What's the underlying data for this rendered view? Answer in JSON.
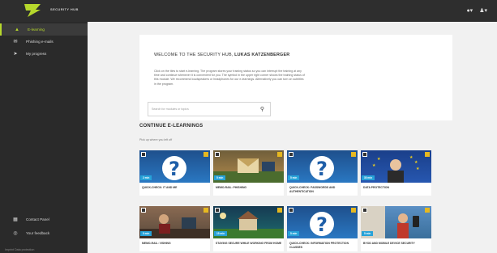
{
  "app": {
    "name": "SECURITY HUB",
    "brand_color": "#b6d82c"
  },
  "topbar": {
    "globe_icon": "globe-icon",
    "user_icon": "user-icon"
  },
  "sidebar": {
    "items": [
      {
        "label": "E-learning",
        "icon": "graduation-cap-icon",
        "active": true
      },
      {
        "label": "Phishing e-mails",
        "icon": "mail-icon",
        "active": false
      },
      {
        "label": "My progress",
        "icon": "progress-icon",
        "active": false
      },
      {
        "label": "Contact Panel",
        "icon": "contact-icon",
        "active": false
      },
      {
        "label": "Your feedback",
        "icon": "feedback-icon",
        "active": false
      }
    ],
    "footer": "Imprint  Data protection"
  },
  "welcome": {
    "title_prefix": "WELCOME TO THE SECURITY HUB, ",
    "title_name": "LUKAS KATZENBERGER",
    "text": "Click on the tiles to start e-learning. The program stores your training status so you can interrupt the training at any time and continue whenever it is convenient for you. The symbol in the upper right corner shows the training status of this module. We recommend loudspeakers or headphones for our e-learnings. Alternatively you can turn on subtitles in the program.",
    "search_placeholder": "Search for modules or topics"
  },
  "continue": {
    "title": "CONTINUE E-LEARNINGS",
    "subtitle": "Pick up where you left off"
  },
  "cards": [
    {
      "title": "QUICK-CHECK: IT AND ME",
      "duration": "2 min"
    },
    {
      "title": "MEMO-RAIL: PHISHING",
      "duration": "5 min"
    },
    {
      "title": "QUICK-CHECK: PASSWORDS AND AUTHENTICATION",
      "duration": "5 min"
    },
    {
      "title": "DATA PROTECTION",
      "duration": "30 min"
    },
    {
      "title": "MEMO-RAIL: VISHING",
      "duration": "5 min"
    },
    {
      "title": "STAYING SECURE WHILE WORKING FROM HOME",
      "duration": "15 min"
    },
    {
      "title": "QUICK-CHECK: INFORMATION PROTECTION CLASSES",
      "duration": "5 min"
    },
    {
      "title": "BYOD AND MOBILE DEVICE SECURITY",
      "duration": "5 min"
    }
  ]
}
